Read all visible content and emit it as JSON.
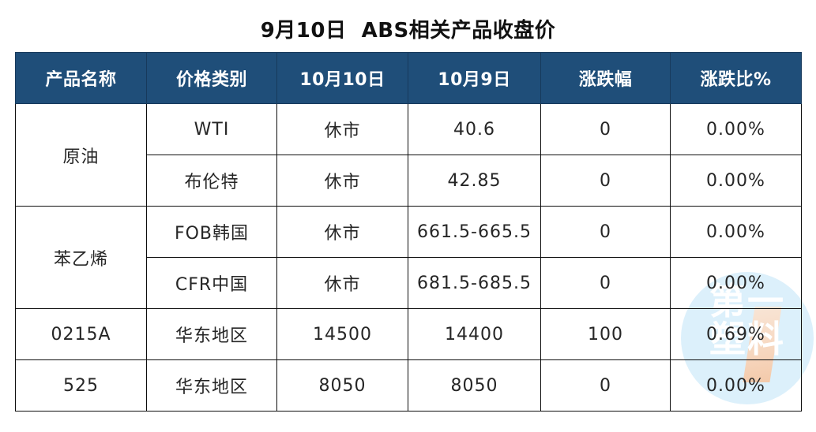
{
  "title": "9月10日  ABS相关产品收盘价",
  "watermark": {
    "line1": "第一",
    "line2": "塑料"
  },
  "colors": {
    "header_bg": "#1f4e79",
    "header_text": "#ffffff",
    "body_text": "#262626",
    "up_red": "#e1121a",
    "watermark_blue": "#dcf0fb",
    "border": "#0d0d0d"
  },
  "table": {
    "headers": [
      "产品名称",
      "价格类别",
      "10月10日",
      "10月9日",
      "涨跌幅",
      "涨跌比%"
    ],
    "rows": [
      {
        "product": "原油",
        "product_rowspan": 2,
        "category": "WTI",
        "price_today": "休市",
        "price_prev": "40.6",
        "change": "0",
        "change_pct": "0.00%",
        "change_up": false
      },
      {
        "product": null,
        "product_rowspan": 0,
        "category": "布伦特",
        "price_today": "休市",
        "price_prev": "42.85",
        "change": "0",
        "change_pct": "0.00%",
        "change_up": false
      },
      {
        "product": "苯乙烯",
        "product_rowspan": 2,
        "category": "FOB韩国",
        "price_today": "休市",
        "price_prev": "661.5-665.5",
        "change": "0",
        "change_pct": "0.00%",
        "change_up": false
      },
      {
        "product": null,
        "product_rowspan": 0,
        "category": "CFR中国",
        "price_today": "休市",
        "price_prev": "681.5-685.5",
        "change": "0",
        "change_pct": "0.00%",
        "change_up": false
      },
      {
        "product": "0215A",
        "product_rowspan": 1,
        "category": "华东地区",
        "price_today": "14500",
        "price_prev": "14400",
        "change": "100",
        "change_pct": "0.69%",
        "change_up": true
      },
      {
        "product": "525",
        "product_rowspan": 1,
        "category": "华东地区",
        "price_today": "8050",
        "price_prev": "8050",
        "change": "0",
        "change_pct": "0.00%",
        "change_up": false
      }
    ]
  }
}
